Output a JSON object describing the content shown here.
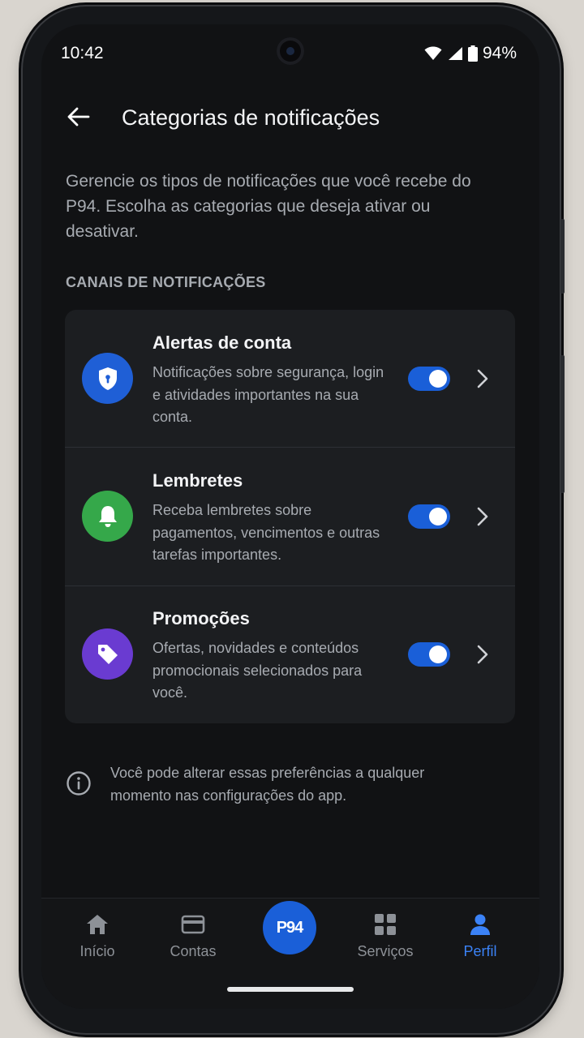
{
  "status": {
    "time": "10:42",
    "battery": "94%"
  },
  "header": {
    "title": "Categorias de notificações"
  },
  "intro": "Gerencie os tipos de notificações que você recebe do P94. Escolha as categorias que deseja ativar ou desativar.",
  "section_title": "CANAIS DE NOTIFICAÇÕES",
  "categories": [
    {
      "title": "Alertas de conta",
      "description": "Notificações sobre segurança, login e atividades importantes na sua conta.",
      "icon": "shield-icon",
      "color": "#1f5fd6",
      "enabled": true
    },
    {
      "title": "Lembretes",
      "description": "Receba lembretes sobre pagamentos, vencimentos e outras tarefas importantes.",
      "icon": "bell-icon",
      "color": "#35a84a",
      "enabled": true
    },
    {
      "title": "Promoções",
      "description": "Ofertas, novidades e conteúdos promocionais selecionados para você.",
      "icon": "tag-icon",
      "color": "#6a3bd1",
      "enabled": true
    }
  ],
  "info_text": "Você pode alterar essas preferências a qualquer momento nas configurações do app.",
  "nav": {
    "items": [
      {
        "label": "Início",
        "icon": "home-icon"
      },
      {
        "label": "Contas",
        "icon": "card-icon"
      },
      {
        "label": "Serviços",
        "icon": "grid-icon"
      },
      {
        "label": "Perfil",
        "icon": "person-icon",
        "active": true
      }
    ],
    "fab_label": "P94"
  },
  "colors": {
    "accent": "#1a5fd8",
    "accent_text": "#3b82f6",
    "background": "#111214",
    "card": "#1c1e21"
  }
}
